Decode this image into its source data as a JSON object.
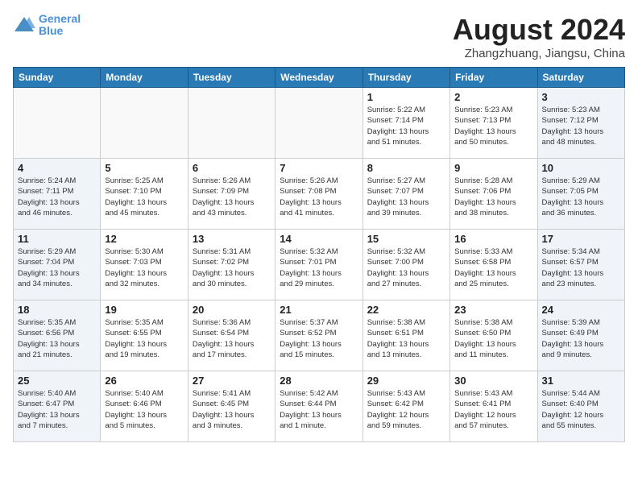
{
  "header": {
    "logo_line1": "General",
    "logo_line2": "Blue",
    "month_year": "August 2024",
    "location": "Zhangzhuang, Jiangsu, China"
  },
  "days_of_week": [
    "Sunday",
    "Monday",
    "Tuesday",
    "Wednesday",
    "Thursday",
    "Friday",
    "Saturday"
  ],
  "weeks": [
    [
      {
        "day": "",
        "info": ""
      },
      {
        "day": "",
        "info": ""
      },
      {
        "day": "",
        "info": ""
      },
      {
        "day": "",
        "info": ""
      },
      {
        "day": "1",
        "info": "Sunrise: 5:22 AM\nSunset: 7:14 PM\nDaylight: 13 hours\nand 51 minutes."
      },
      {
        "day": "2",
        "info": "Sunrise: 5:23 AM\nSunset: 7:13 PM\nDaylight: 13 hours\nand 50 minutes."
      },
      {
        "day": "3",
        "info": "Sunrise: 5:23 AM\nSunset: 7:12 PM\nDaylight: 13 hours\nand 48 minutes."
      }
    ],
    [
      {
        "day": "4",
        "info": "Sunrise: 5:24 AM\nSunset: 7:11 PM\nDaylight: 13 hours\nand 46 minutes."
      },
      {
        "day": "5",
        "info": "Sunrise: 5:25 AM\nSunset: 7:10 PM\nDaylight: 13 hours\nand 45 minutes."
      },
      {
        "day": "6",
        "info": "Sunrise: 5:26 AM\nSunset: 7:09 PM\nDaylight: 13 hours\nand 43 minutes."
      },
      {
        "day": "7",
        "info": "Sunrise: 5:26 AM\nSunset: 7:08 PM\nDaylight: 13 hours\nand 41 minutes."
      },
      {
        "day": "8",
        "info": "Sunrise: 5:27 AM\nSunset: 7:07 PM\nDaylight: 13 hours\nand 39 minutes."
      },
      {
        "day": "9",
        "info": "Sunrise: 5:28 AM\nSunset: 7:06 PM\nDaylight: 13 hours\nand 38 minutes."
      },
      {
        "day": "10",
        "info": "Sunrise: 5:29 AM\nSunset: 7:05 PM\nDaylight: 13 hours\nand 36 minutes."
      }
    ],
    [
      {
        "day": "11",
        "info": "Sunrise: 5:29 AM\nSunset: 7:04 PM\nDaylight: 13 hours\nand 34 minutes."
      },
      {
        "day": "12",
        "info": "Sunrise: 5:30 AM\nSunset: 7:03 PM\nDaylight: 13 hours\nand 32 minutes."
      },
      {
        "day": "13",
        "info": "Sunrise: 5:31 AM\nSunset: 7:02 PM\nDaylight: 13 hours\nand 30 minutes."
      },
      {
        "day": "14",
        "info": "Sunrise: 5:32 AM\nSunset: 7:01 PM\nDaylight: 13 hours\nand 29 minutes."
      },
      {
        "day": "15",
        "info": "Sunrise: 5:32 AM\nSunset: 7:00 PM\nDaylight: 13 hours\nand 27 minutes."
      },
      {
        "day": "16",
        "info": "Sunrise: 5:33 AM\nSunset: 6:58 PM\nDaylight: 13 hours\nand 25 minutes."
      },
      {
        "day": "17",
        "info": "Sunrise: 5:34 AM\nSunset: 6:57 PM\nDaylight: 13 hours\nand 23 minutes."
      }
    ],
    [
      {
        "day": "18",
        "info": "Sunrise: 5:35 AM\nSunset: 6:56 PM\nDaylight: 13 hours\nand 21 minutes."
      },
      {
        "day": "19",
        "info": "Sunrise: 5:35 AM\nSunset: 6:55 PM\nDaylight: 13 hours\nand 19 minutes."
      },
      {
        "day": "20",
        "info": "Sunrise: 5:36 AM\nSunset: 6:54 PM\nDaylight: 13 hours\nand 17 minutes."
      },
      {
        "day": "21",
        "info": "Sunrise: 5:37 AM\nSunset: 6:52 PM\nDaylight: 13 hours\nand 15 minutes."
      },
      {
        "day": "22",
        "info": "Sunrise: 5:38 AM\nSunset: 6:51 PM\nDaylight: 13 hours\nand 13 minutes."
      },
      {
        "day": "23",
        "info": "Sunrise: 5:38 AM\nSunset: 6:50 PM\nDaylight: 13 hours\nand 11 minutes."
      },
      {
        "day": "24",
        "info": "Sunrise: 5:39 AM\nSunset: 6:49 PM\nDaylight: 13 hours\nand 9 minutes."
      }
    ],
    [
      {
        "day": "25",
        "info": "Sunrise: 5:40 AM\nSunset: 6:47 PM\nDaylight: 13 hours\nand 7 minutes."
      },
      {
        "day": "26",
        "info": "Sunrise: 5:40 AM\nSunset: 6:46 PM\nDaylight: 13 hours\nand 5 minutes."
      },
      {
        "day": "27",
        "info": "Sunrise: 5:41 AM\nSunset: 6:45 PM\nDaylight: 13 hours\nand 3 minutes."
      },
      {
        "day": "28",
        "info": "Sunrise: 5:42 AM\nSunset: 6:44 PM\nDaylight: 13 hours\nand 1 minute."
      },
      {
        "day": "29",
        "info": "Sunrise: 5:43 AM\nSunset: 6:42 PM\nDaylight: 12 hours\nand 59 minutes."
      },
      {
        "day": "30",
        "info": "Sunrise: 5:43 AM\nSunset: 6:41 PM\nDaylight: 12 hours\nand 57 minutes."
      },
      {
        "day": "31",
        "info": "Sunrise: 5:44 AM\nSunset: 6:40 PM\nDaylight: 12 hours\nand 55 minutes."
      }
    ]
  ]
}
